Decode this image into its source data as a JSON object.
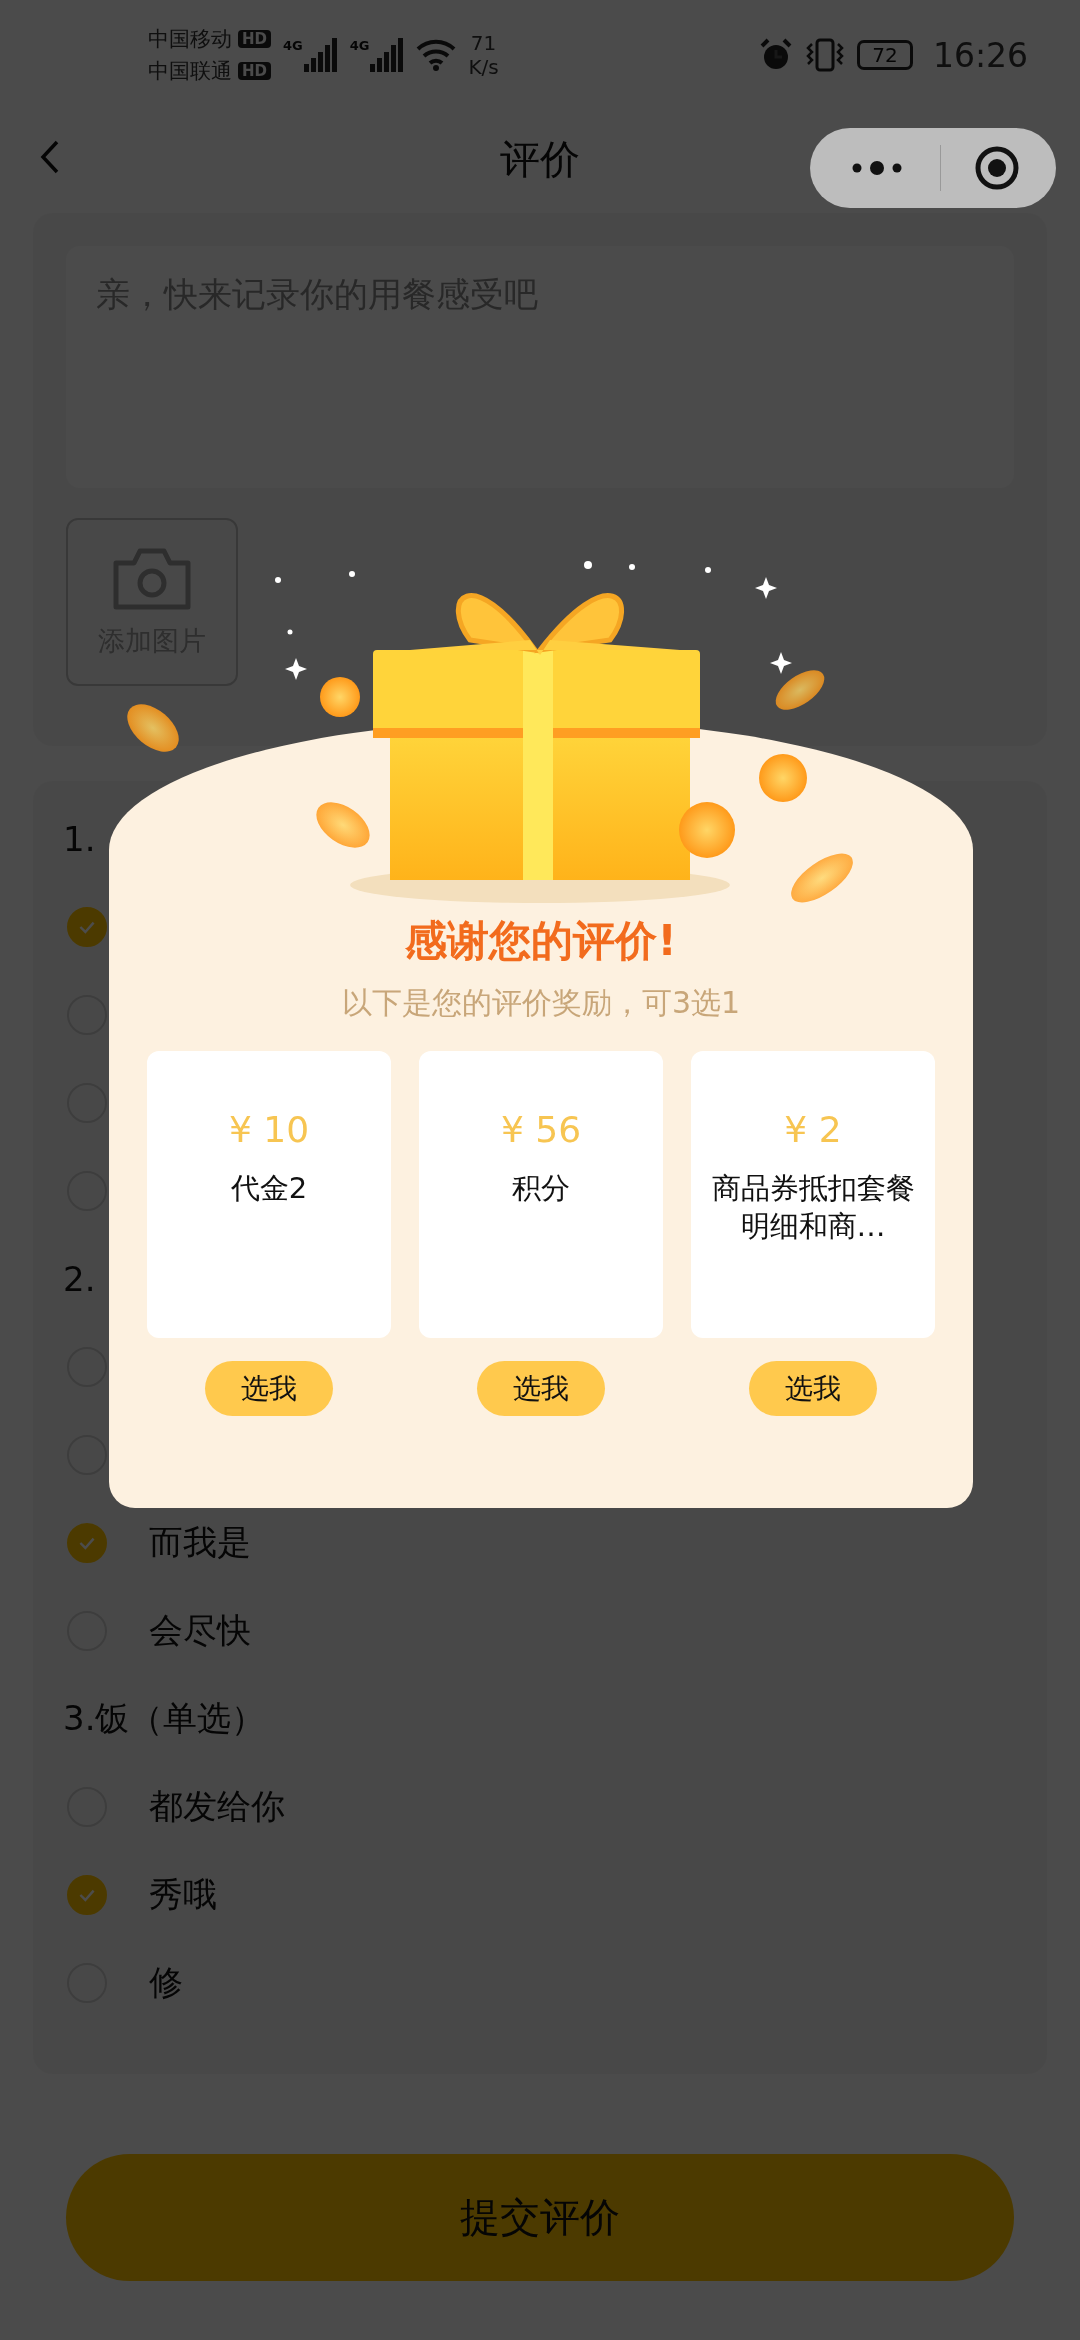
{
  "status_bar": {
    "carriers": [
      {
        "name": "中国移动",
        "badge": "HD"
      },
      {
        "name": "中国联通",
        "badge": "HD"
      }
    ],
    "signals": [
      {
        "type": "4G"
      },
      {
        "type": "4G"
      }
    ],
    "network_speed": {
      "value": "71",
      "unit": "K/s"
    },
    "battery": "72",
    "time": "16:26"
  },
  "nav": {
    "title": "评价"
  },
  "review": {
    "placeholder": "亲，快来记录你的用餐感受吧",
    "add_photo": "添加图片"
  },
  "questions": [
    {
      "title": "1.",
      "options": [
        {
          "selected": true
        },
        {
          "selected": false
        },
        {
          "selected": false
        },
        {
          "selected": false
        }
      ]
    },
    {
      "title": "2.",
      "options": [
        {
          "selected": false
        },
        {
          "selected": false
        },
        {
          "label": "而我是",
          "selected": true
        },
        {
          "label": "会尽快",
          "selected": false
        }
      ]
    },
    {
      "title": "3.饭（单选）",
      "options": [
        {
          "label": "都发给你",
          "selected": false
        },
        {
          "label": "秀哦",
          "selected": true
        },
        {
          "label": "修",
          "selected": false
        }
      ]
    }
  ],
  "submit": "提交评价",
  "reward_dialog": {
    "title": "感谢您的评价!",
    "subtitle": "以下是您的评价奖励，可3选1",
    "rewards": [
      {
        "amount": "¥ 10",
        "name": "代金2",
        "button": "选我"
      },
      {
        "amount": "¥ 56",
        "name": "积分",
        "button": "选我"
      },
      {
        "amount": "¥ 2",
        "name": "商品券抵扣套餐明细和商…",
        "button": "选我"
      }
    ]
  }
}
